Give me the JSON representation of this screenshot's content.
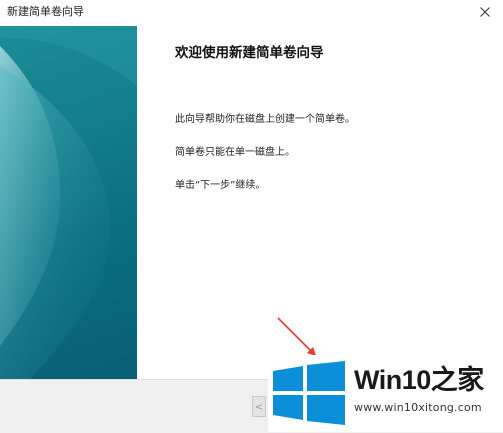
{
  "window": {
    "title": "新建简单卷向导"
  },
  "content": {
    "heading": "欢迎使用新建简单卷向导",
    "paragraphs": [
      "此向导帮助你在磁盘上创建一个简单卷。",
      "简单卷只能在单一磁盘上。",
      "单击“下一步”继续。"
    ]
  },
  "footer": {
    "back_label": "<"
  },
  "watermark": {
    "brand": "Win10之家",
    "url": "www.win10xitong.com"
  },
  "colors": {
    "side_panel": "#137f8c",
    "logo_blue": "#0a8fd8",
    "arrow": "#e83a2f"
  }
}
